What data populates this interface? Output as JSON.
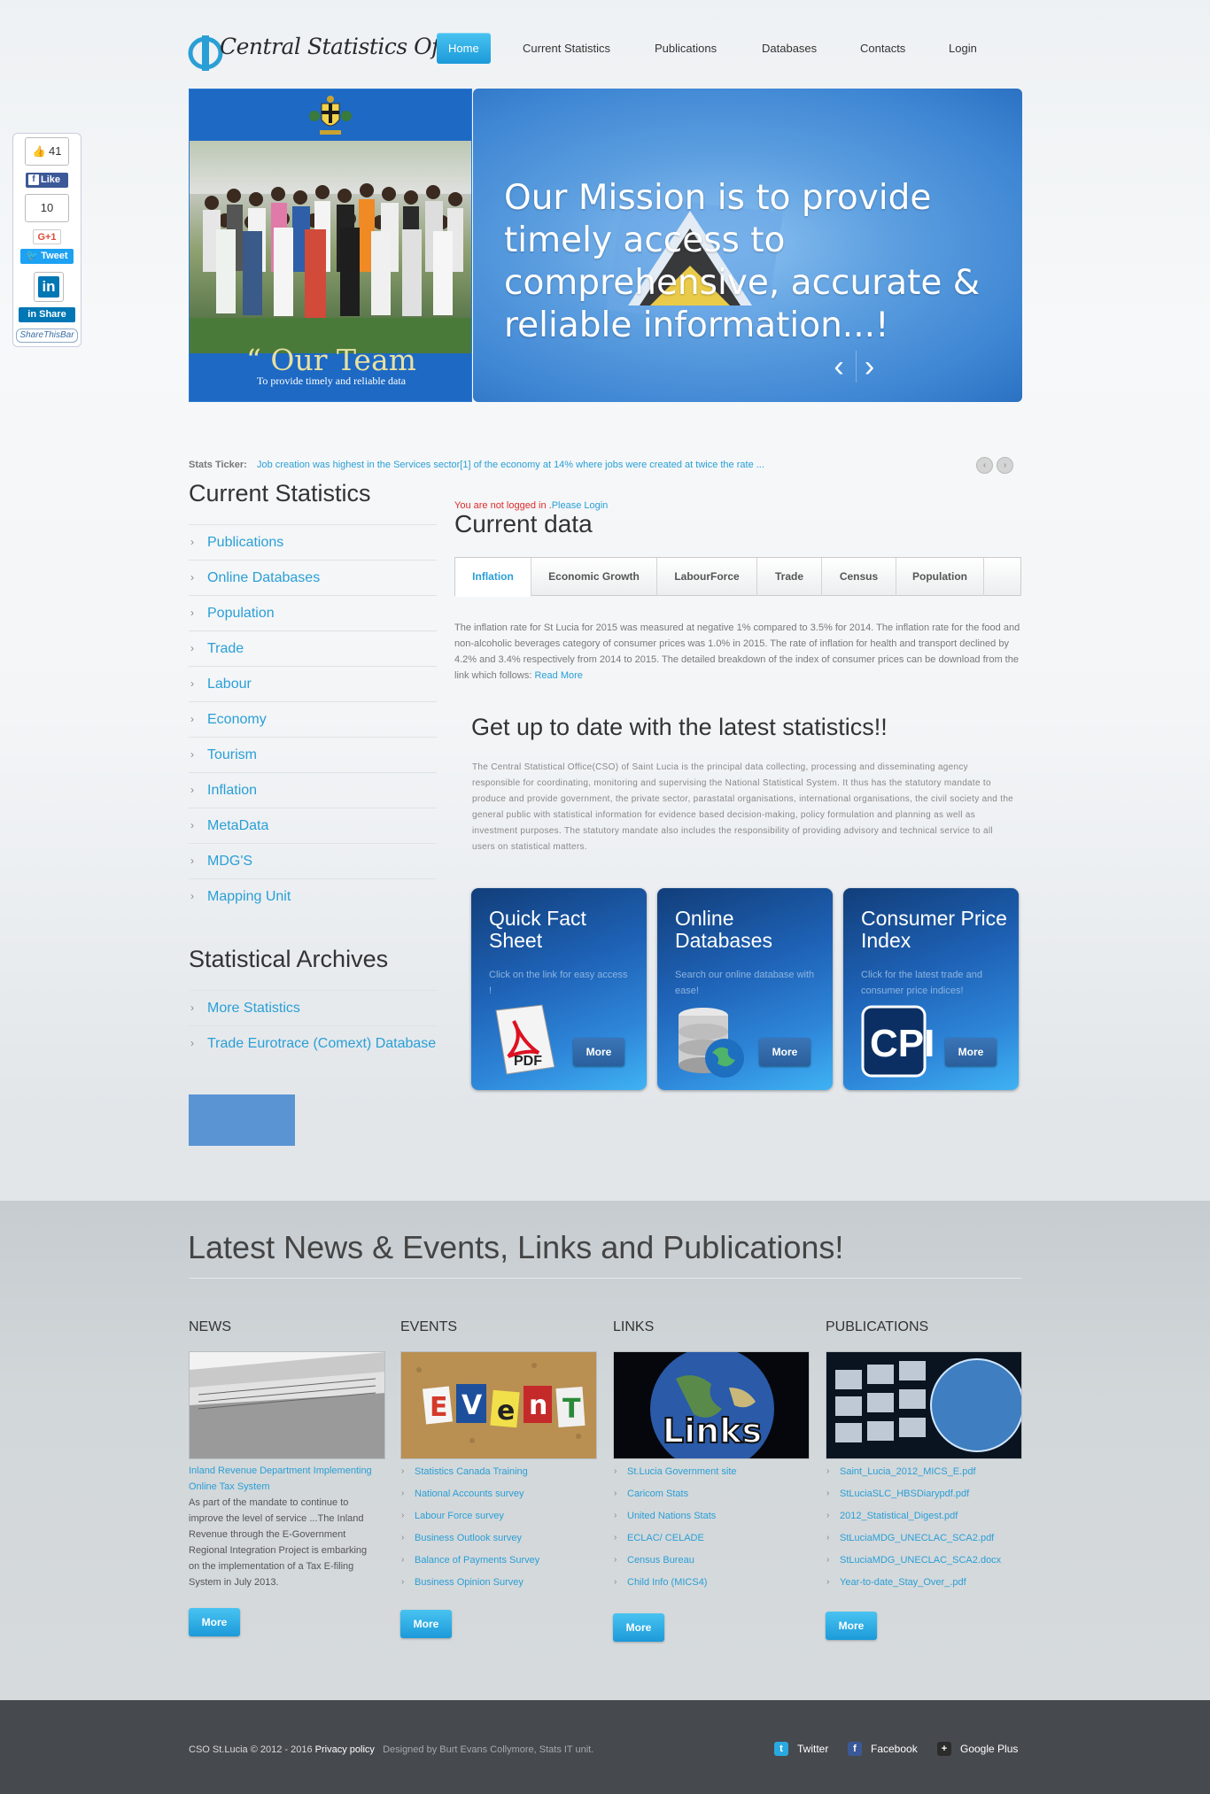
{
  "header": {
    "logo_text": "Central Statistics Office",
    "nav": [
      "Home",
      "Current Statistics",
      "Publications",
      "Databases",
      "Contacts",
      "Login"
    ]
  },
  "share_bar": {
    "like_count": "41",
    "fb_label": "Like",
    "gplus_count": "10",
    "gplus_label": "G+1",
    "tweet_label": "Tweet",
    "li_label": "in",
    "li_share_label": "Share",
    "stb_label": "ShareThisBar"
  },
  "hero": {
    "team_caption": "“ Our Team",
    "team_sub": "To provide timely and reliable data",
    "mission": "Our Mission is to provide timely access to comprehensive, accurate & reliable information...!",
    "prev": "‹",
    "next": "›"
  },
  "ticker": {
    "label": "Stats Ticker:",
    "text": "Job creation was highest in the Services sector[1] of the economy at 14% where jobs were created at twice the rate ...",
    "prev": "‹",
    "next": "›"
  },
  "sidebar": {
    "heading": "Current Statistics",
    "items": [
      "Publications",
      "Online Databases",
      "Population",
      "Trade",
      "Labour",
      "Economy",
      "Tourism",
      "Inflation",
      "MetaData",
      "MDG'S",
      "Mapping Unit"
    ],
    "archives_heading": "Statistical Archives",
    "archives": [
      "More Statistics",
      "Trade Eurotrace (Comext) Database"
    ]
  },
  "main": {
    "login_red": "You are not logged in .",
    "login_link": "Please Login",
    "heading": "Current data",
    "tabs": [
      "Inflation",
      "Economic Growth",
      "LabourForce",
      "Trade",
      "Census",
      "Population"
    ],
    "inflation_text": "The inflation rate for St Lucia for 2015 was measured at negative 1% compared to 3.5% for 2014. The inflation rate for the food and non-alcoholic beverages category of consumer prices was 1.0% in 2015. The rate of inflation for health and transport declined by 4.2% and 3.4% respectively from 2014 to 2015. The detailed breakdown of the index of consumer prices can be download from the link which follows:",
    "read_more": "Read More",
    "latest_heading": "Get up to date with the latest statistics!!",
    "about": "The Central Statistical Office(CSO) of Saint Lucia is the principal data collecting, processing and disseminating agency responsible for coordinating, monitoring and supervising the National Statistical System. It thus has the statutory mandate to produce and provide government, the private sector, parastatal organisations, international organisations, the civil society and the general public with statistical information for evidence based decision-making, policy formulation and planning as well as investment purposes. The statutory mandate also includes the responsibility of providing advisory and technical service to all users on statistical matters.",
    "boxes": [
      {
        "title": "Quick Fact Sheet",
        "desc": "Click on the link for easy access !",
        "more": "More",
        "icon": "pdf-icon"
      },
      {
        "title": "Online Databases",
        "desc": "Search our online database with ease!",
        "more": "More",
        "icon": "database-icon"
      },
      {
        "title": "Consumer Price Index",
        "desc": "Click for the latest trade and consumer price indices!",
        "more": "More",
        "icon": "cpi-icon"
      }
    ]
  },
  "news_band": {
    "heading": "Latest News & Events, Links and Publications!",
    "news": {
      "heading": "NEWS",
      "title": "Inland Revenue Department Implementing Online Tax System",
      "body": "As part of the mandate to continue to improve the level of service ...The Inland Revenue through the E-Government Regional Integration Project is embarking on the implementation of a Tax E-filing System in July 2013.",
      "more": "More"
    },
    "events": {
      "heading": "EVENTS",
      "items": [
        "Statistics Canada Training",
        "National Accounts survey",
        "Labour Force survey",
        "Business Outlook survey",
        "Balance of Payments Survey",
        "Business Opinion Survey"
      ],
      "more": "More",
      "image_letters": [
        "E",
        "V",
        "e",
        "n",
        "T"
      ]
    },
    "links": {
      "heading": "LINKS",
      "items": [
        "St.Lucia Government site",
        "Caricom Stats",
        "United Nations Stats",
        "ECLAC/ CELADE",
        "Census Bureau",
        "Child Info (MICS4)"
      ],
      "more": "More",
      "image_word": "Links"
    },
    "publications": {
      "heading": "PUBLICATIONS",
      "items": [
        "Saint_Lucia_2012_MICS_E.pdf",
        "StLuciaSLC_HBSDiarypdf.pdf",
        "2012_Statistical_Digest.pdf",
        "StLuciaMDG_UNECLAC_SCA2.pdf",
        "StLuciaMDG_UNECLAC_SCA2.docx",
        "Year-to-date_Stay_Over_.pdf"
      ],
      "more": "More"
    }
  },
  "footer": {
    "copyright": "CSO St.Lucia © 2012 - 2016 ",
    "privacy": "Privacy policy",
    "designed": "Designed by Burt Evans Collymore, Stats IT unit.",
    "social": [
      "Twitter",
      "Facebook",
      "Google Plus"
    ]
  },
  "colors": {
    "accent": "#2a9fd6",
    "nav_active": "#1c9ad9",
    "box_blue": "#1e62b6",
    "footer": "#464a4f",
    "login_warning": "#e02b2b"
  }
}
